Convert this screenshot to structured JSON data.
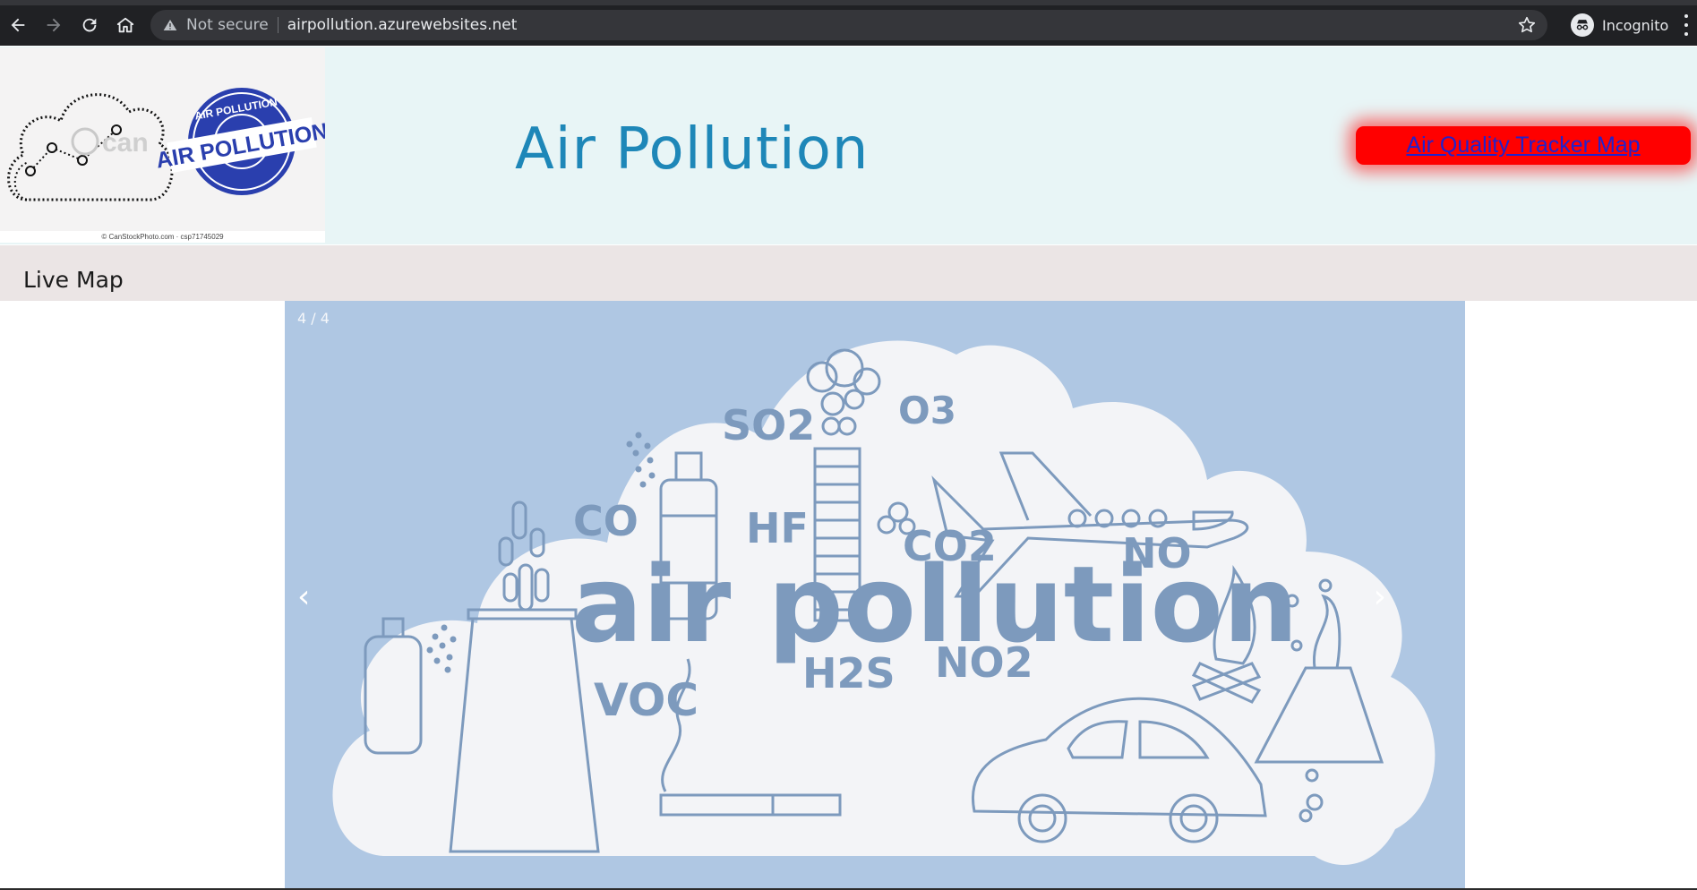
{
  "browser": {
    "security_label": "Not secure",
    "url": "airpollution.azurewebsites.net",
    "profile_label": "Incognito"
  },
  "header": {
    "logo_stamp_top": "AIR POLLUTION",
    "logo_stamp_main": "AIR POLLUTION",
    "logo_credit": "© CanStockPhoto.com · csp71745029",
    "title": "Air Pollution",
    "tracker_link_label": "Air Quality Tracker Map"
  },
  "section": {
    "title": "Live Map"
  },
  "slideshow": {
    "counter": "4 / 4",
    "prev_label": "‹",
    "next_label": "›",
    "slide": {
      "headline": "air pollution",
      "labels": [
        "SO2",
        "O3",
        "CO",
        "HF",
        "CO2",
        "NO",
        "VOC",
        "H2S",
        "NO2"
      ]
    }
  },
  "colors": {
    "chrome_bg": "#202124",
    "header_bg": "#e8f5f6",
    "title_color": "#1e87b8",
    "button_bg": "#ff0000",
    "section_bar_bg": "#ebe5e5",
    "slide_bg": "#afc7e3",
    "slide_ink": "#7d9abd"
  }
}
